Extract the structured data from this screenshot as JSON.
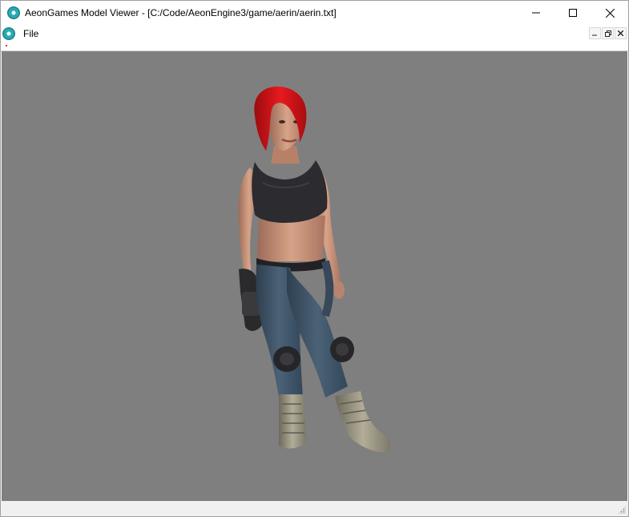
{
  "window": {
    "title": "AeonGames Model Viewer - [C:/Code/AeonEngine3/game/aerin/aerin.txt]",
    "icon": "aeon-logo-icon",
    "controls": {
      "minimize": "—",
      "maximize": "☐",
      "close": "✕"
    }
  },
  "menubar": {
    "icon": "aeon-logo-icon",
    "items": [
      {
        "label": "File"
      }
    ],
    "mdi_controls": {
      "minimize": "_",
      "restore": "❐",
      "close": "✕"
    }
  },
  "viewport": {
    "background": "#7f7f7f",
    "content": "3d-character-model"
  },
  "colors": {
    "hair": "#d0141a",
    "skin": "#c9947a",
    "top": "#2c2c30",
    "pants": "#3f5366",
    "boots": "#8f8a78"
  }
}
